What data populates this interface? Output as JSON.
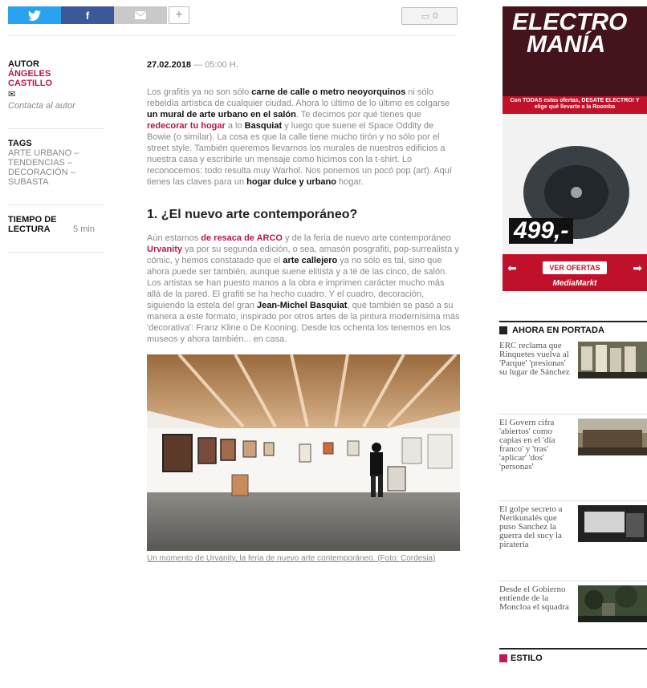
{
  "share": {
    "twitter_icon": "twitter-bird-icon",
    "facebook_label": "f",
    "mail_icon": "envelope-icon",
    "plus_label": "+",
    "comments_label": "0"
  },
  "meta": {
    "author_label": "AUTOR",
    "author_name": "ÁNGELES CASTILLO",
    "contact_label": "Contacta al autor",
    "tags_label": "TAGS",
    "tags": [
      "ARTE URBANO –",
      "TENDENCIAS –",
      "DECORACIÓN –",
      "SUBASTA"
    ],
    "reading_label": "TIEMPO DE LECTURA",
    "reading_value": "5 min"
  },
  "article": {
    "date": "27.02.2018",
    "time": "— 05:00 H.",
    "p1": [
      {
        "t": "Los grafitis ya no son sólo ",
        "s": "n"
      },
      {
        "t": "carne de calle o metro neoyorquinos",
        "s": "b"
      },
      {
        "t": " ni sólo rebeldía artística de cualquier ciudad. Ahora lo último de lo último es colgarse ",
        "s": "n"
      },
      {
        "t": "un mural de arte urbano en el salón",
        "s": "b"
      },
      {
        "t": ". Te decimos por qué tienes que ",
        "s": "n"
      },
      {
        "t": "redecorar tu hogar",
        "s": "h"
      },
      {
        "t": " a lo ",
        "s": "n"
      },
      {
        "t": "Basquiat",
        "s": "b"
      },
      {
        "t": " y luego que suene el Space Oddity de Bowie (o similar). La cosa es que la calle tiene mucho tirón y no sólo por el street style. También queremos llevarnos los murales de nuestros edificios a nuestra casa y escribirle un mensaje como hicimos con la t-shirt. Lo reconocemos: todo resulta muy Warhol. Nos ponemos un pocó pop (art). Aquí tienes las claves para un ",
        "s": "n"
      },
      {
        "t": "hogar dulce y urbano",
        "s": "b"
      },
      {
        "t": " hogar.",
        "s": "n"
      }
    ],
    "heading": "1. ¿El nuevo arte contemporáneo?",
    "p2": [
      {
        "t": "Aún estamos ",
        "s": "n"
      },
      {
        "t": "de resaca de ARCO",
        "s": "h"
      },
      {
        "t": " y de la feria de nuevo arte contemporáneo ",
        "s": "n"
      },
      {
        "t": "Urvanity",
        "s": "h"
      },
      {
        "t": " ya por su segunda edición, o sea, amasón posgrafiti, pop-surrealista y cómic, y hemos constatado que el ",
        "s": "n"
      },
      {
        "t": "arte callejero",
        "s": "b"
      },
      {
        "t": " ya no sólo es tal, sino que ahora puede ser también, aunque suene elitista y a té de las cinco, de salón. Los artistas se han puesto manos a la obra e imprimen carácter mucho más allá de la pared. El grafiti se ha hecho cuadro. Y el cuadro, decoración, siguiendo la estela del gran ",
        "s": "n"
      },
      {
        "t": "Jean-Michel Basquiat",
        "s": "b"
      },
      {
        "t": ", que también se pasó a su manera a este formato, inspirado por otros artes de la pintura modernísima más 'decorativa': Franz Kline o De Kooning. Desde los ochenta los tenemos en los museos y ahora también... en casa.",
        "s": "n"
      }
    ],
    "caption": "Un momento de Urvanity, la feria de nuevo arte contemporáneo. (Foto: Cordesia)"
  },
  "ad": {
    "title_line1": "ELECTRO",
    "title_line2": "MANÍA",
    "promo": "Con TODAS estas ofertas, DESATE ELECTRO! Y elige qué llevarte a la Roomba",
    "price": "499,-",
    "cta": "VER OFERTAS",
    "brand": "MediaMarkt"
  },
  "sidebar": {
    "section_title": "AHORA EN PORTADA",
    "news": [
      {
        "title": "ERC reclama que Rinquetes vuelva al 'Parque' 'presionas' su lugar de Sánchez"
      },
      {
        "title": "El Govern cifra 'abiertos' como capias en el 'día franco' y 'tras' 'aplicar' 'dos' 'personas'"
      },
      {
        "title": "El golpe secreto a Nerikunalés que puso Sanchez la guerra del sucy la piratería"
      },
      {
        "title": "Desde el Gobierno entiende de la Moncloa el squadra"
      }
    ],
    "section2_title": "ESTILO"
  }
}
